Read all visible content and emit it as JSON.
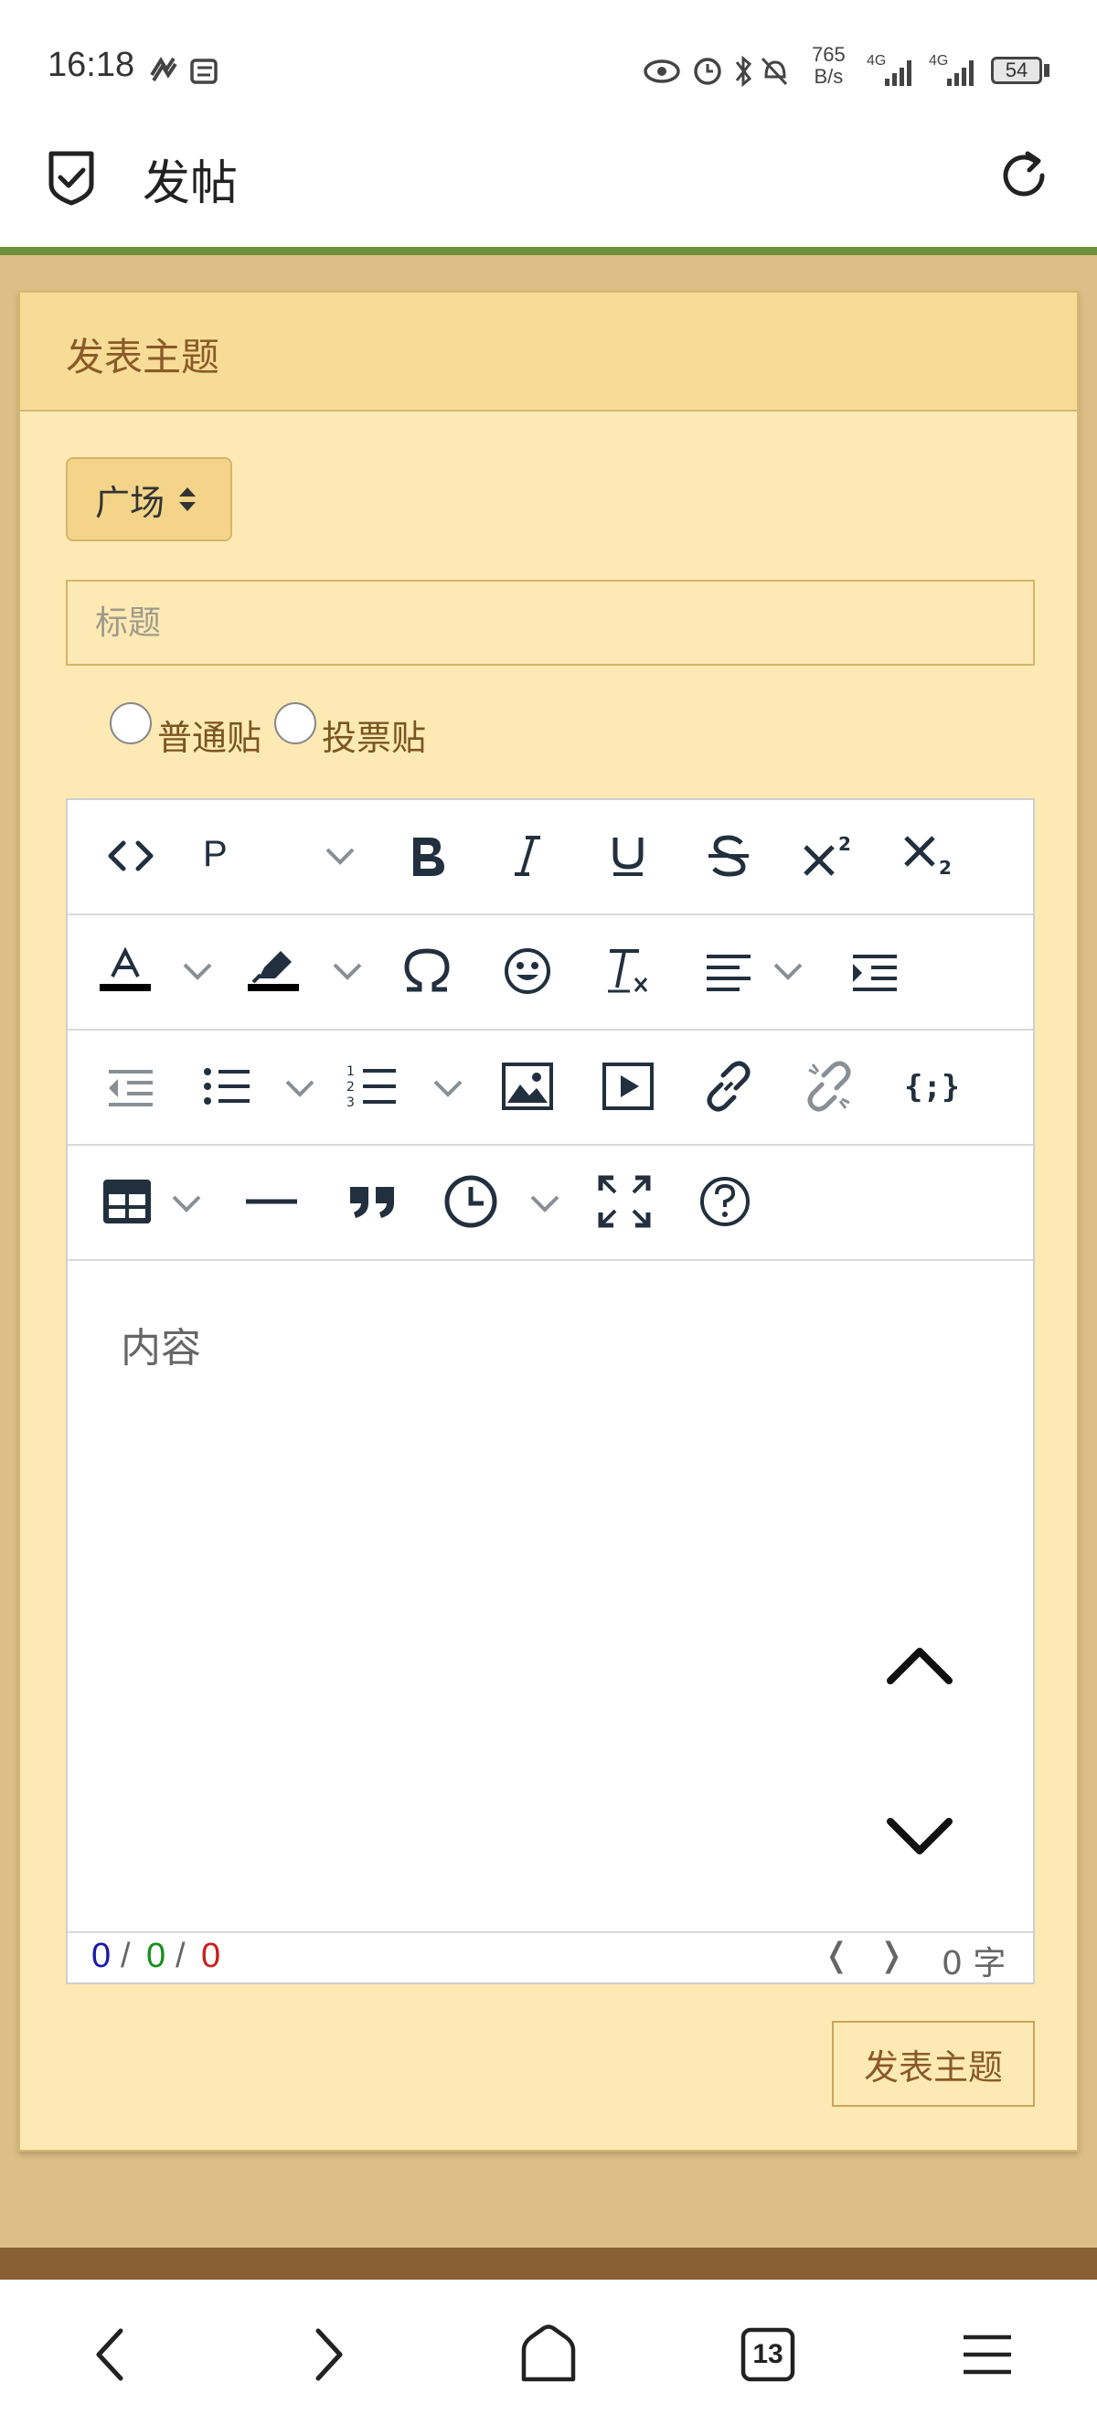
{
  "status_bar": {
    "time": "16:18",
    "net_speed_value": "765",
    "net_speed_unit": "B/s",
    "signal1": "4G",
    "signal2": "4G",
    "battery": "54"
  },
  "app_bar": {
    "title": "发帖"
  },
  "card": {
    "header": "发表主题",
    "forum_select_value": "广场",
    "title_placeholder": "标题",
    "radio_normal": "普通贴",
    "radio_vote": "投票贴"
  },
  "editor": {
    "block_format": "P",
    "content_placeholder": "内容",
    "counts": [
      "0",
      "0",
      "0"
    ],
    "separator": "/",
    "prev": "❬",
    "next": "❭",
    "char_count": "0 字",
    "toolbar_icons": [
      "source-code-icon",
      "format-select",
      "bold-icon",
      "italic-icon",
      "underline-icon",
      "strikethrough-icon",
      "superscript-icon",
      "subscript-icon",
      "font-color-icon",
      "highlight-icon",
      "special-char-icon",
      "emoji-icon",
      "clear-format-icon",
      "align-left-icon",
      "indent-icon",
      "outdent-icon",
      "bullet-list-icon",
      "numbered-list-icon",
      "image-icon",
      "media-icon",
      "link-icon",
      "unlink-icon",
      "code-sample-icon",
      "table-icon",
      "horizontal-rule-icon",
      "blockquote-icon",
      "datetime-icon",
      "fullscreen-icon",
      "help-icon"
    ]
  },
  "submit_label": "发表主题",
  "bottom_nav": {
    "tabs_count": "13"
  },
  "colors": {
    "accent_green": "#6e8f3e",
    "card_bg": "#fde9b4",
    "page_bg": "#dcbf86",
    "count_blue": "#1a1aa8",
    "count_green": "#17911a",
    "count_red": "#cc1d1d"
  }
}
